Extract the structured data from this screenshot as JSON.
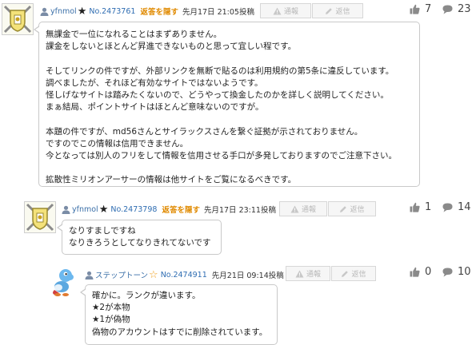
{
  "labels": {
    "hide": "返答を隠す",
    "report": "通報",
    "reply": "返信"
  },
  "posts": [
    {
      "user": "yfnmol",
      "star_color": "#222222",
      "id": "No.2473761",
      "date": "先月17日 21:05投稿",
      "likes": "7",
      "replies": "23",
      "lines": [
        "無課金で一位になれることはまずありません。",
        "課金をしないとほとんど昇進できないものと思って宜しい程です。",
        "",
        "そしてリンクの件ですが、外部リンクを無断で貼るのは利用規約の第5条に違反しています。",
        "調べましたが、それほど有効なサイトではないようです。",
        "怪しげなサイトは踏みたくないので、どうやって換金したのかを詳しく説明してください。",
        "まぁ結局、ポイントサイトはほとんど意味ないのですが。",
        "",
        "本題の件ですが、md56さんとサイラックスさんを繋ぐ証拠が示されておりません。",
        "ですのでこの情報は信用できません。",
        "今となっては別人のフリをして情報を信用させる手口が多発しておりますのでご注意下さい。",
        "",
        "拡散性ミリオンアーサーの情報は他サイトをご覧になるべきです。"
      ]
    },
    {
      "user": "yfnmol",
      "star_color": "#222222",
      "id": "No.2473798",
      "date": "先月17日 23:11投稿",
      "likes": "1",
      "replies": "14",
      "lines": [
        "なりすましですね",
        "なりきろうとしてなりきれてないです"
      ]
    },
    {
      "user": "ステップトーン",
      "star_color": "#f0a020",
      "id": "No.2474911",
      "date": "先月21日 09:14投稿",
      "likes": "0",
      "replies": "10",
      "lines": [
        "確かに。ランクが違います。",
        "★2が本物",
        "★1が偽物",
        "偽物のアカウントはすでに削除されています。"
      ]
    }
  ]
}
